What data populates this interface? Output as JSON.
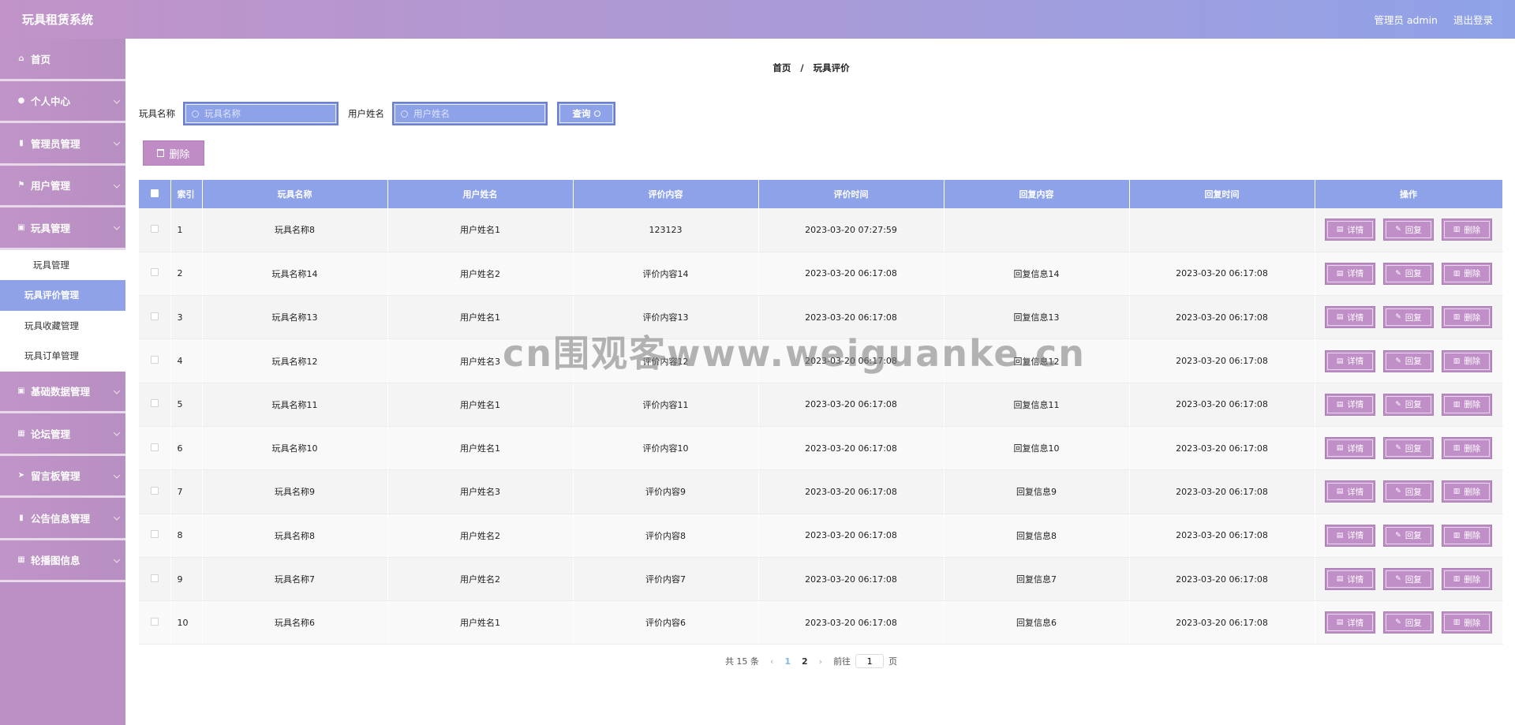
{
  "header": {
    "title": "玩具租赁系统",
    "user_label": "管理员 admin",
    "logout_label": "退出登录"
  },
  "sidebar": {
    "items_before": [
      {
        "label": "首页",
        "icon": "⌂",
        "has_children": false
      },
      {
        "label": "个人中心",
        "icon": "●",
        "has_children": true
      },
      {
        "label": "管理员管理",
        "icon": "▮",
        "has_children": true
      },
      {
        "label": "用户管理",
        "icon": "⚑",
        "has_children": true
      },
      {
        "label": "玩具管理",
        "icon": "▣",
        "has_children": true
      }
    ],
    "submenu": [
      {
        "label": "玩具管理",
        "active": false
      },
      {
        "label": "玩具评价管理",
        "active": true
      },
      {
        "label": "玩具收藏管理",
        "active": false
      },
      {
        "label": "玩具订单管理",
        "active": false
      }
    ],
    "items_after": [
      {
        "label": "基础数据管理",
        "icon": "▣"
      },
      {
        "label": "论坛管理",
        "icon": "▦"
      },
      {
        "label": "留言板管理",
        "icon": "➤"
      },
      {
        "label": "公告信息管理",
        "icon": "▮"
      },
      {
        "label": "轮播图信息",
        "icon": "▦"
      }
    ]
  },
  "breadcrumb": {
    "home": "首页",
    "sep": "/",
    "current": "玩具评价"
  },
  "search": {
    "toy_label": "玩具名称",
    "toy_placeholder": "玩具名称",
    "user_label": "用户姓名",
    "user_placeholder": "用户姓名",
    "query_label": "查询"
  },
  "delete_label": "删除",
  "table": {
    "headers": [
      "索引",
      "玩具名称",
      "用户姓名",
      "评价内容",
      "评价时间",
      "回复内容",
      "回复时间",
      "操作"
    ],
    "rows": [
      [
        "1",
        "玩具名称8",
        "用户姓名1",
        "123123",
        "2023-03-20 07:27:59",
        "",
        ""
      ],
      [
        "2",
        "玩具名称14",
        "用户姓名2",
        "评价内容14",
        "2023-03-20 06:17:08",
        "回复信息14",
        "2023-03-20 06:17:08"
      ],
      [
        "3",
        "玩具名称13",
        "用户姓名1",
        "评价内容13",
        "2023-03-20 06:17:08",
        "回复信息13",
        "2023-03-20 06:17:08"
      ],
      [
        "4",
        "玩具名称12",
        "用户姓名3",
        "评价内容12",
        "2023-03-20 06:17:08",
        "回复信息12",
        "2023-03-20 06:17:08"
      ],
      [
        "5",
        "玩具名称11",
        "用户姓名1",
        "评价内容11",
        "2023-03-20 06:17:08",
        "回复信息11",
        "2023-03-20 06:17:08"
      ],
      [
        "6",
        "玩具名称10",
        "用户姓名1",
        "评价内容10",
        "2023-03-20 06:17:08",
        "回复信息10",
        "2023-03-20 06:17:08"
      ],
      [
        "7",
        "玩具名称9",
        "用户姓名3",
        "评价内容9",
        "2023-03-20 06:17:08",
        "回复信息9",
        "2023-03-20 06:17:08"
      ],
      [
        "8",
        "玩具名称8",
        "用户姓名2",
        "评价内容8",
        "2023-03-20 06:17:08",
        "回复信息8",
        "2023-03-20 06:17:08"
      ],
      [
        "9",
        "玩具名称7",
        "用户姓名2",
        "评价内容7",
        "2023-03-20 06:17:08",
        "回复信息7",
        "2023-03-20 06:17:08"
      ],
      [
        "10",
        "玩具名称6",
        "用户姓名1",
        "评价内容6",
        "2023-03-20 06:17:08",
        "回复信息6",
        "2023-03-20 06:17:08"
      ]
    ],
    "ops": {
      "detail": "详情",
      "reply": "回复",
      "delete": "删除"
    }
  },
  "pagination": {
    "total": "共 15 条",
    "pages": [
      "1",
      "2"
    ],
    "current": "1",
    "goto_prefix": "前往",
    "goto_value": "1",
    "goto_suffix": "页"
  },
  "watermark": "cn围观客www.weiguanke.cn",
  "colors": {
    "accent": "#8ea2ea",
    "sidebar": "#bb90c4",
    "button": "#c08fc8"
  }
}
